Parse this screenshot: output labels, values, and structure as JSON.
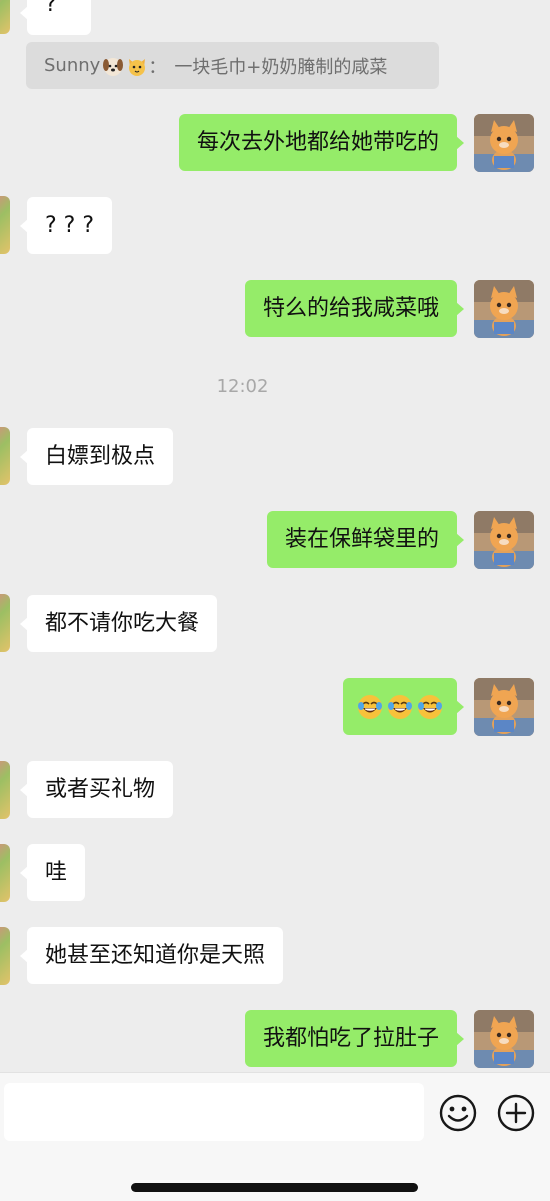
{
  "top_fragment": "?",
  "quote": {
    "sender": "Sunny",
    "text": "一块毛巾+奶奶腌制的咸菜"
  },
  "timestamp": "12:02",
  "messages": [
    {
      "side": "right",
      "text": "每次去外地都给她带吃的"
    },
    {
      "side": "left",
      "text": "? ? ?"
    },
    {
      "side": "right",
      "text": "特么的给我咸菜哦"
    },
    {
      "side": "left",
      "text": "白嫖到极点"
    },
    {
      "side": "right",
      "text": "装在保鲜袋里的"
    },
    {
      "side": "left",
      "text": "都不请你吃大餐"
    },
    {
      "side": "right",
      "text": "",
      "emoji": "crying-laughing-face ×3"
    },
    {
      "side": "left",
      "text": "或者买礼物"
    },
    {
      "side": "left",
      "text": "哇"
    },
    {
      "side": "left",
      "text": "她甚至还知道你是天照"
    },
    {
      "side": "right",
      "text": "我都怕吃了拉肚子"
    }
  ],
  "input": {
    "value": ""
  },
  "icons": {
    "emoji_button": "smiley-icon",
    "more_button": "plus-circle-icon"
  },
  "colors": {
    "background": "#ededed",
    "own_bubble": "#95ec69",
    "other_bubble": "#ffffff"
  }
}
